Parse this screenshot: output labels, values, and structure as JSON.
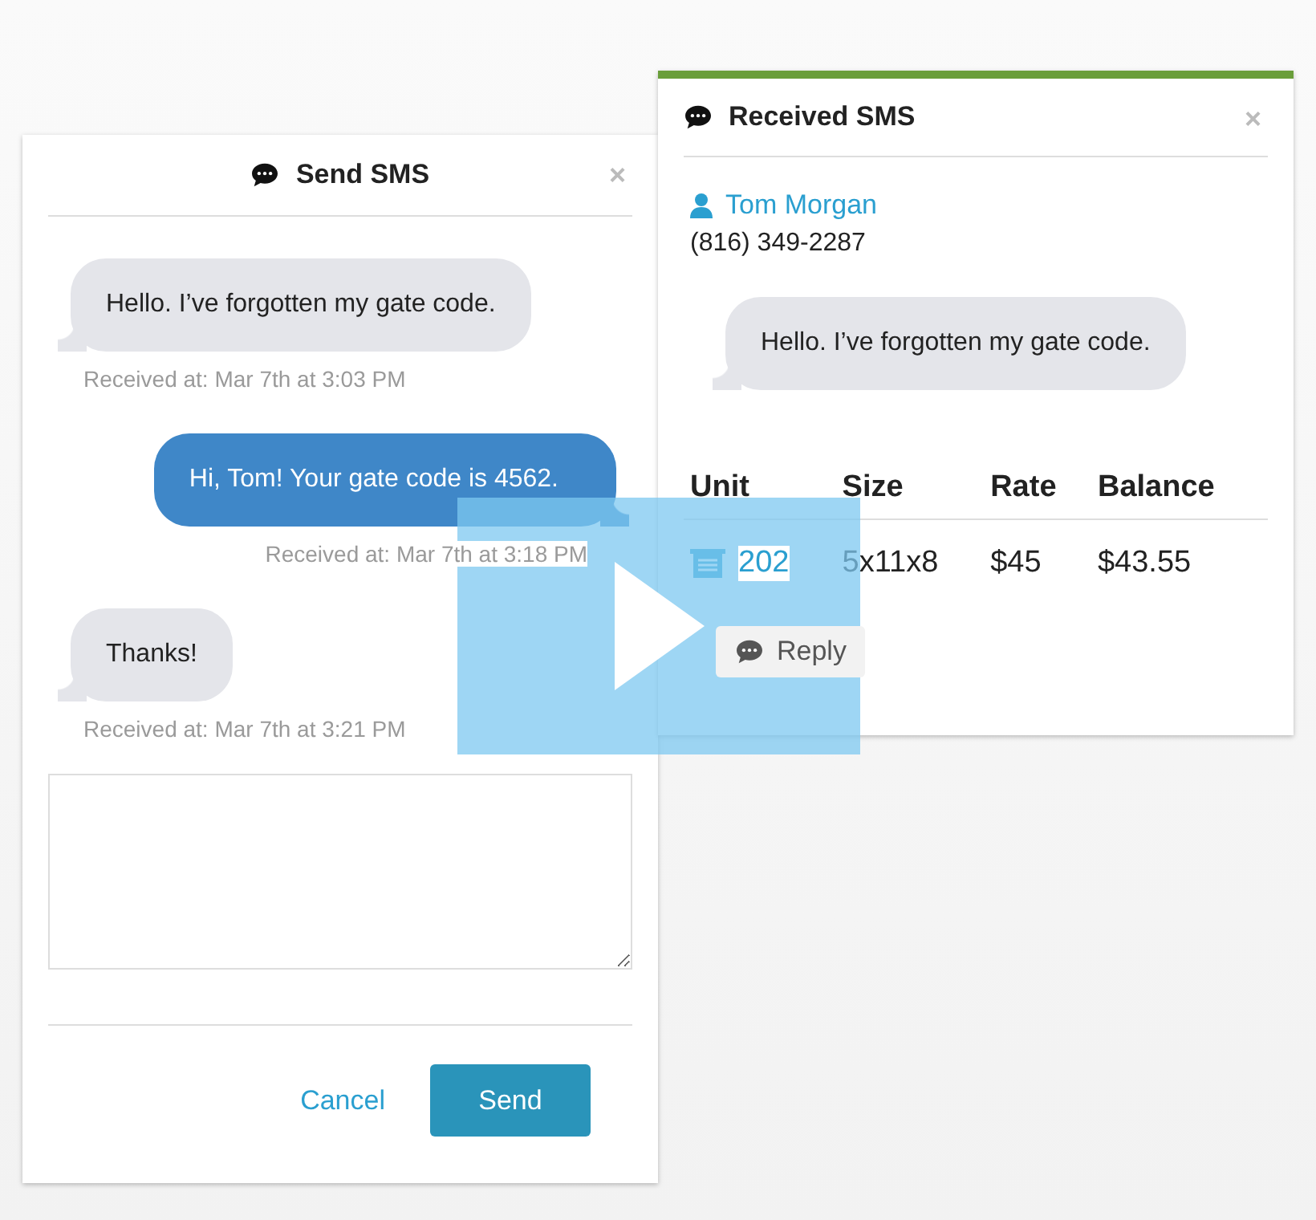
{
  "send_sms": {
    "title": "Send SMS",
    "close": "×",
    "messages": [
      {
        "kind": "incoming",
        "text": "Hello. I’ve forgotten my gate code.",
        "time": "Received at: Mar 7th at 3:03 PM"
      },
      {
        "kind": "outgoing",
        "text": "Hi, Tom! Your gate code is 4562.",
        "time": "Received at: Mar 7th at 3:18 PM"
      },
      {
        "kind": "incoming",
        "text": "Thanks!",
        "time": "Received at: Mar 7th at 3:21 PM"
      }
    ],
    "buttons": {
      "cancel": "Cancel",
      "send": "Send"
    }
  },
  "received_sms": {
    "title": "Received SMS",
    "close": "×",
    "contact": {
      "name": "Tom Morgan",
      "phone": "(816) 349-2287"
    },
    "message": "Hello. I’ve forgotten my gate code.",
    "table": {
      "columns": [
        "Unit",
        "Size",
        "Rate",
        "Balance"
      ],
      "rows": [
        [
          "202",
          "5x11x8",
          "$45",
          "$43.55"
        ]
      ]
    },
    "reply": "Reply"
  }
}
